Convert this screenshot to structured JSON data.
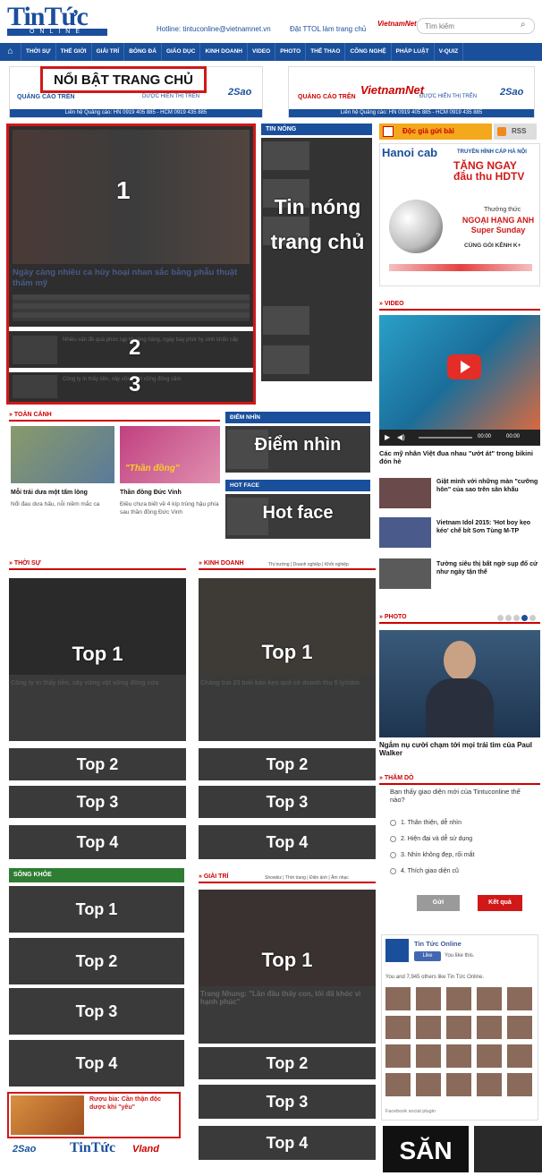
{
  "header": {
    "logo_main": "TinTức",
    "logo_sub": "ONLINE",
    "hotline": "Hotline: tintuconline@vietnamnet.vn",
    "register": "Đặt TTOL làm trang chủ",
    "vnet": "VietnamNet",
    "search_placeholder": "Tìm kiếm"
  },
  "nav": [
    "THỜI SỰ",
    "THẾ GIỚI",
    "GIẢI TRÍ",
    "BÓNG ĐÁ",
    "GIÁO DỤC",
    "KINH DOANH",
    "VIDEO",
    "PHOTO",
    "THỂ THAO",
    "CÔNG NGHỆ",
    "PHÁP LUẬT",
    "V-QUIZ"
  ],
  "ads": {
    "left_text": "QUẢNG CÁO TRÊN",
    "left_brand": "DƯỢC HIỂN THỊ TRÊN",
    "left_bar": "Liên hệ Quảng cáo: HN 0919 405 885 - HCM 0919 435 885",
    "right_text": "QUẢNG CÁO TRÊN",
    "right_brand": "ĐƯỢC HIỂN THỊ TRÊN",
    "right_bar": "Liên hệ Quảng cáo: HN 0919 405 885 - HCM 0919 435 885",
    "logo2": "2Sao",
    "vietnamnet": "VietnamNet"
  },
  "highlight": {
    "title": "NỔI BẬT TRANG CHỦ",
    "n1": "1",
    "n2": "2",
    "n3": "3",
    "headline": "Ngày càng nhiều ca hủy hoại nhan sắc bằng phẫu thuật thẩm mỹ",
    "sub2": "Nhiều vấn đề quá phức tạp khoảng hàng, ngày bay phút hy sinh khẩn cấp",
    "sub3": "Công ty in thẩy tiền, xây vững vật vững đông cảm"
  },
  "hot": {
    "header": "TIN NÓNG",
    "label": "Tin nóng trang chủ"
  },
  "right": {
    "reader": "Độc giả gửi bài",
    "rss": "RSS",
    "cab_brand": "Hanoi cab",
    "cab_line1": "TRUYỀN HÌNH CÁP HÀ NỘI",
    "cab_line2": "TẶNG NGAY đầu thu HDTV",
    "cab_line3": "Thưởng thức",
    "cab_line4": "NGOẠI HẠNG ANH Super Sunday",
    "cab_line5": "CÙNG GÓI KÊNH K+",
    "video_header": "VIDEO",
    "video_caption": "Các mỹ nhân Việt đua nhau \"ướt át\" trong bikini đón hè",
    "time": "00:00",
    "rel1": "Giật mình với những màn \"cưỡng hôn\" của sao trên sân khấu",
    "rel2": "Vietnam Idol 2015: 'Hot boy kẹo kéo' chế bít Sơn Tùng M-TP",
    "rel3": "Tường siêu thị bất ngờ sụp đổ cứ như ngày tận thế",
    "photo_header": "PHOTO",
    "photo_caption": "Ngắm nụ cười chạm tới mọi trái tim của Paul Walker",
    "poll_header": "THĂM DÒ",
    "poll_q": "Bạn thấy giao diện mới của Tintuconline thế nào?",
    "poll_opts": [
      "1. Thân thiện, dễ nhìn",
      "2. Hiện đại và dễ sử dụng",
      "3. Nhìn không đẹp, rối mắt",
      "4. Thích giao diện cũ"
    ],
    "vote": "Gửi",
    "result": "Kết quả",
    "fb_name": "Tin Tức Online",
    "fb_like": "Like",
    "fb_like_text": "You like this.",
    "fb_count": "You and 7,945 others like Tin Tức Online.",
    "fb_plugin": "Facebook social plugin",
    "san": "SĂN"
  },
  "panorama": {
    "header": "TOÀN CẢNH",
    "cap1": "Mỗi trái dưa một tấm lòng",
    "cap1b": "Nổi đau dưa hấu, nỗi niềm mắc ca",
    "cap2": "Thần đồng Đức Vinh",
    "cap2b": "Điều chưa biết về 4 kíp trùng hậu phía sau thần đồng Đức Vinh",
    "badge": "\"Thần đồng\""
  },
  "diem": {
    "header": "ĐIỂM NHÌN",
    "label": "Điểm nhìn"
  },
  "hotface": {
    "header": "HOT FACE",
    "label": "Hot face"
  },
  "thoisu": {
    "header": "THỜI SỰ",
    "headline": "Công ty in thẩy tiền, xây vững vật vững đông cửa",
    "top1": "Top 1",
    "top2": "Top 2",
    "top3": "Top 3",
    "top4": "Top 4"
  },
  "kinhdoanh": {
    "header": "KINH DOANH",
    "sub": "Thị trường | Doanh nghiệp | Khởi nghiệp",
    "headline": "Chàng trai 23 tuổi bán kẹo quê có doanh thu 5 tỷ/năm",
    "top1": "Top 1",
    "top2": "Top 2",
    "top3": "Top 3",
    "top4": "Top 4"
  },
  "songkhoe": {
    "header": "SỐNG KHỎE",
    "top1": "Top 1",
    "top2": "Top 2",
    "top3": "Top 3",
    "top4": "Top 4",
    "last": "Rượu bia: Cần thận độc dược khi \"yêu\""
  },
  "giaitri": {
    "header": "GIẢI TRÍ",
    "sub": "Showbiz | Thời trang | Điện ảnh | Âm nhạc",
    "headline": "Trang Nhung: \"Lần đầu thấy con, tôi đã khóc vì hạnh phúc\"",
    "top1": "Top 1",
    "top2": "Top 2",
    "top3": "Top 3",
    "top4": "Top 4"
  },
  "footer": {
    "a": "2Sao",
    "b": "TinTức",
    "c": "Vland"
  }
}
